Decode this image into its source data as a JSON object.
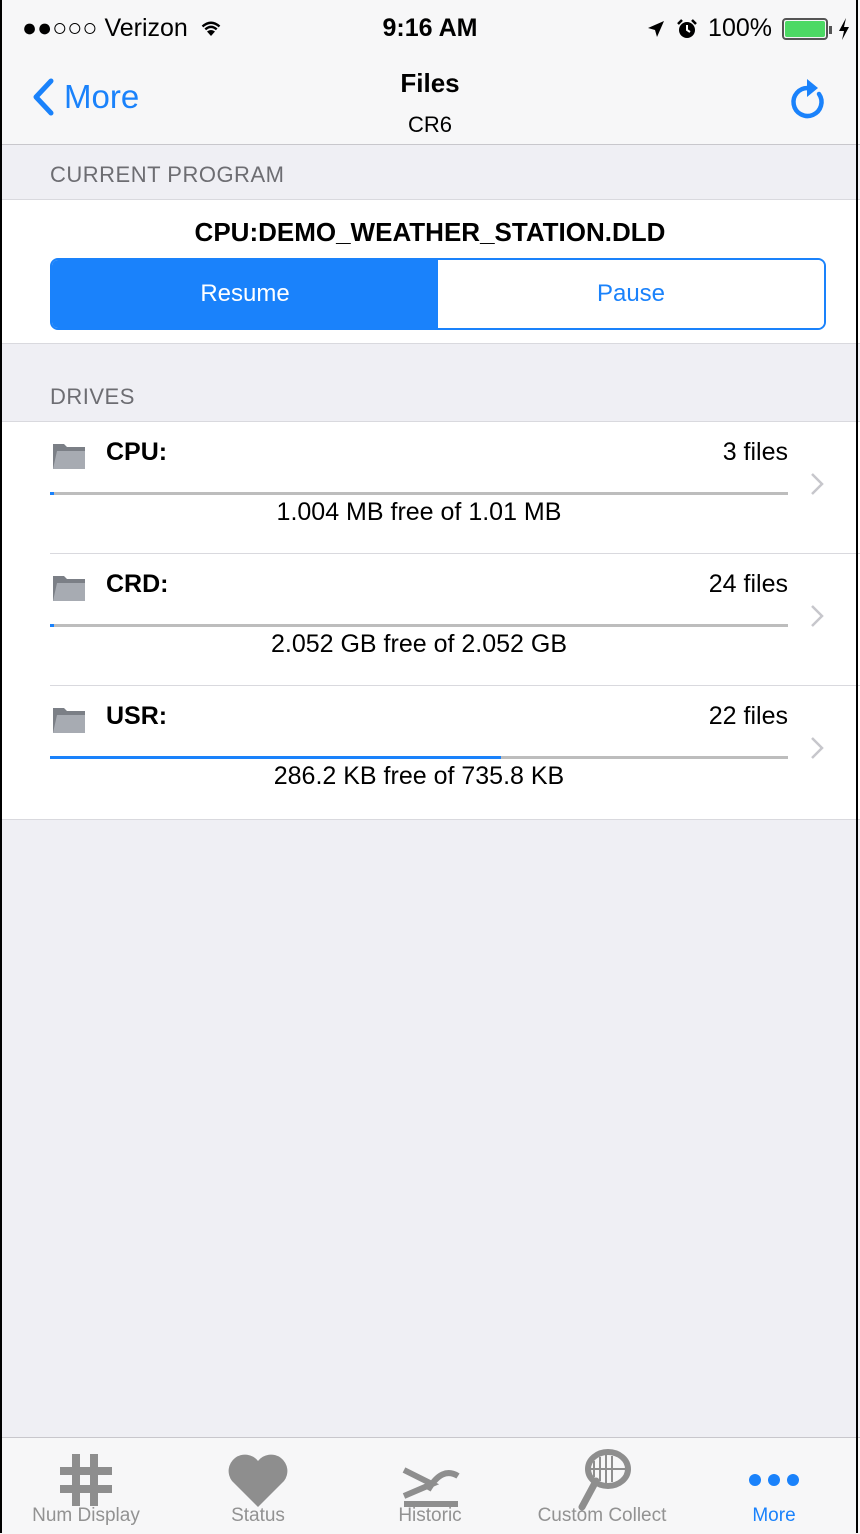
{
  "status_bar": {
    "carrier": "●●○○○ Verizon",
    "time": "9:16 AM",
    "battery": "100%",
    "battery_color": "#4cd964"
  },
  "nav": {
    "back_label": "More",
    "title": "Files",
    "subtitle": "CR6",
    "accent": "#1a82fb"
  },
  "current_program": {
    "header": "CURRENT PROGRAM",
    "name": "CPU:DEMO_WEATHER_STATION.DLD",
    "segments": [
      {
        "label": "Resume",
        "selected": true
      },
      {
        "label": "Pause",
        "selected": false
      }
    ]
  },
  "drives": {
    "header": "DRIVES",
    "items": [
      {
        "name": "CPU:",
        "count": "3 files",
        "free": "1.004 MB free of 1.01 MB",
        "used_fraction": 0.006
      },
      {
        "name": "CRD:",
        "count": "24 files",
        "free": "2.052 GB free of 2.052 GB",
        "used_fraction": 0.006
      },
      {
        "name": "USR:",
        "count": "22 files",
        "free": "286.2 KB free of 735.8 KB",
        "used_fraction": 0.611
      }
    ]
  },
  "tabs": [
    {
      "label": "Num Display",
      "icon": "hash-icon"
    },
    {
      "label": "Status",
      "icon": "heart-icon"
    },
    {
      "label": "Historic",
      "icon": "historic-icon"
    },
    {
      "label": "Custom Collect",
      "icon": "butterfly-net-icon"
    },
    {
      "label": "More",
      "icon": "more-dots-icon",
      "selected": true
    }
  ]
}
